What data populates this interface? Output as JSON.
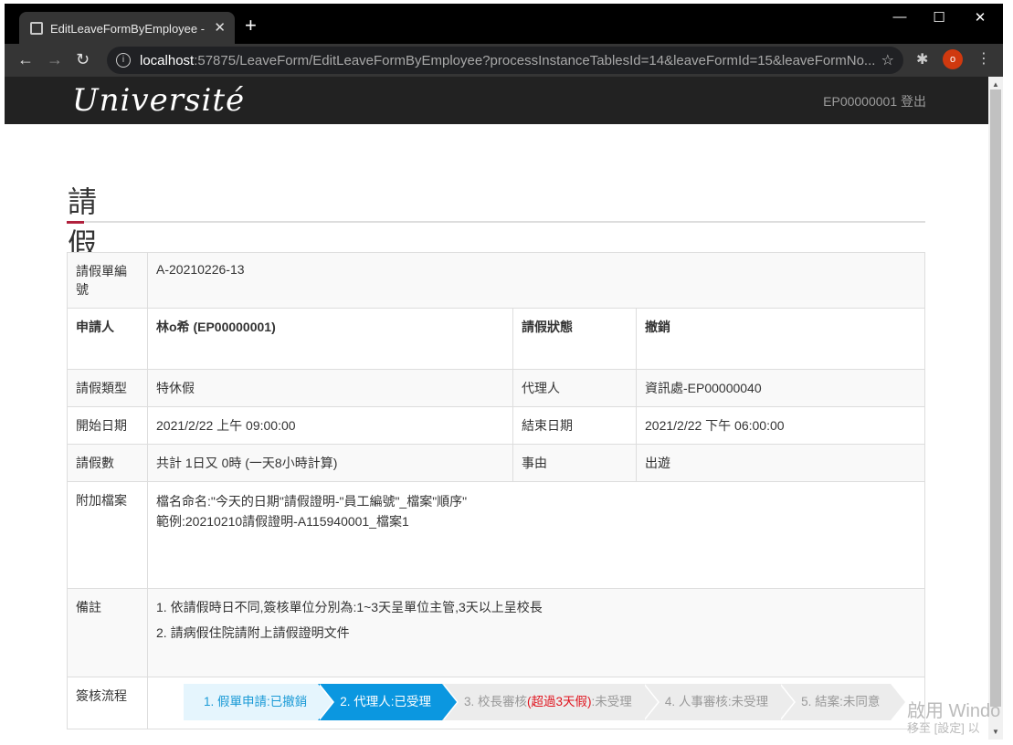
{
  "browser": {
    "tab_title": "EditLeaveFormByEmployee - M",
    "url_host": "localhost",
    "url_rest": ":57875/LeaveForm/EditLeaveFormByEmployee?processInstanceTablesId=14&leaveFormId=15&leaveFormNo...",
    "profile_initial": "o",
    "new_tab": "+",
    "close_tab": "✕"
  },
  "navbar": {
    "brand": "Université",
    "user_id": "EP00000001",
    "logout": "登出"
  },
  "page_title": "請假單",
  "form": {
    "form_no_label": "請假單編號",
    "form_no": "A-20210226-13",
    "applicant_label": "申請人",
    "applicant": "林o希 (EP00000001)",
    "status_label": "請假狀態",
    "status": "撤銷",
    "leave_type_label": "請假類型",
    "leave_type": "特休假",
    "agent_label": "代理人",
    "agent": "資訊處-EP00000040",
    "start_label": "開始日期",
    "start": "2021/2/22 上午 09:00:00",
    "end_label": "結束日期",
    "end": "2021/2/22 下午 06:00:00",
    "days_label": "請假數",
    "days": "共計 1日又 0時 (一天8小時計算)",
    "reason_label": "事由",
    "reason": "出遊",
    "attach_label": "附加檔案",
    "attach_line1": "檔名命名:\"今天的日期\"請假證明-\"員工編號\"_檔案\"順序\"",
    "attach_line2": "範例:20210210請假證明-A115940001_檔案1",
    "remark_label": "備註",
    "remark_line1": "1. 依請假時日不同,簽核單位分別為:1~3天呈單位主管,3天以上呈校長",
    "remark_line2": "2. 請病假住院請附上請假證明文件",
    "flow_label": "簽核流程"
  },
  "steps": {
    "s1": "1. 假單申請:已撤銷",
    "s2": "2. 代理人:已受理",
    "s3_pre": "3. 校長審核",
    "s3_warn": "(超過3天假)",
    "s3_post": ":未受理",
    "s4": "4. 人事審核:未受理",
    "s5": "5. 結案:未同意"
  },
  "watermark": {
    "line1": "啟用 Windo",
    "line2": "移至 [設定] 以"
  },
  "colors": {
    "step_done": "#e5f5fd",
    "step_active": "#0b97e0",
    "step_pending": "#ececec",
    "accent": "#b0203c"
  }
}
